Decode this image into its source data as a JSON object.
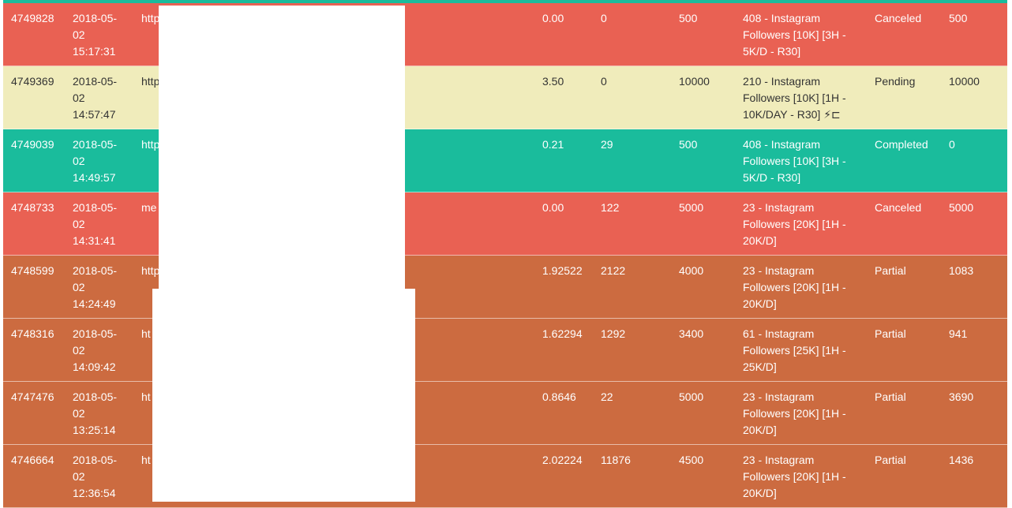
{
  "colors": {
    "top_strip": "#1abc9c",
    "canceled": "#e96153",
    "pending": "#f0ecbb",
    "completed": "#1abc9c",
    "partial": "#cc6b40",
    "redaction": "#ffffff"
  },
  "orders": [
    {
      "id": "4749828",
      "date": "2018-05-\n02\n15:17:31",
      "link": "http",
      "charge": "0.00",
      "start_count": "0",
      "quantity": "500",
      "service": "408 - Instagram\nFollowers [10K] [3H -\n5K/D - R30]",
      "status": "Canceled",
      "remains": "500",
      "state": "canceled"
    },
    {
      "id": "4749369",
      "date": "2018-05-\n02\n14:57:47",
      "link": "http",
      "charge": "3.50",
      "start_count": "0",
      "quantity": "10000",
      "service": "210 - Instagram\nFollowers [10K] [1H -\n10K/DAY - R30] ⚡⊏",
      "status": "Pending",
      "remains": "10000",
      "state": "pending"
    },
    {
      "id": "4749039",
      "date": "2018-05-\n02\n14:49:57",
      "link": "http",
      "charge": "0.21",
      "start_count": "29",
      "quantity": "500",
      "service": "408 - Instagram\nFollowers [10K] [3H -\n5K/D - R30]",
      "status": "Completed",
      "remains": "0",
      "state": "completed"
    },
    {
      "id": "4748733",
      "date": "2018-05-\n02\n14:31:41",
      "link": "me",
      "charge": "0.00",
      "start_count": "122",
      "quantity": "5000",
      "service": "23 - Instagram\nFollowers [20K] [1H -\n20K/D]",
      "status": "Canceled",
      "remains": "5000",
      "state": "canceled"
    },
    {
      "id": "4748599",
      "date": "2018-05-\n02\n14:24:49",
      "link": "http",
      "charge": "1.92522",
      "start_count": "2122",
      "quantity": "4000",
      "service": "23 - Instagram\nFollowers [20K] [1H -\n20K/D]",
      "status": "Partial",
      "remains": "1083",
      "state": "partial"
    },
    {
      "id": "4748316",
      "date": "2018-05-\n02\n14:09:42",
      "link": "ht",
      "charge": "1.62294",
      "start_count": "1292",
      "quantity": "3400",
      "service": "61 - Instagram\nFollowers [25K] [1H -\n25K/D]",
      "status": "Partial",
      "remains": "941",
      "state": "partial"
    },
    {
      "id": "4747476",
      "date": "2018-05-\n02\n13:25:14",
      "link": "ht",
      "charge": "0.8646",
      "start_count": "22",
      "quantity": "5000",
      "service": "23 - Instagram\nFollowers [20K] [1H -\n20K/D]",
      "status": "Partial",
      "remains": "3690",
      "state": "partial"
    },
    {
      "id": "4746664",
      "date": "2018-05-\n02\n12:36:54",
      "link": "ht",
      "charge": "2.02224",
      "start_count": "11876",
      "quantity": "4500",
      "service": "23 - Instagram\nFollowers [20K] [1H -\n20K/D]",
      "status": "Partial",
      "remains": "1436",
      "state": "partial"
    }
  ]
}
